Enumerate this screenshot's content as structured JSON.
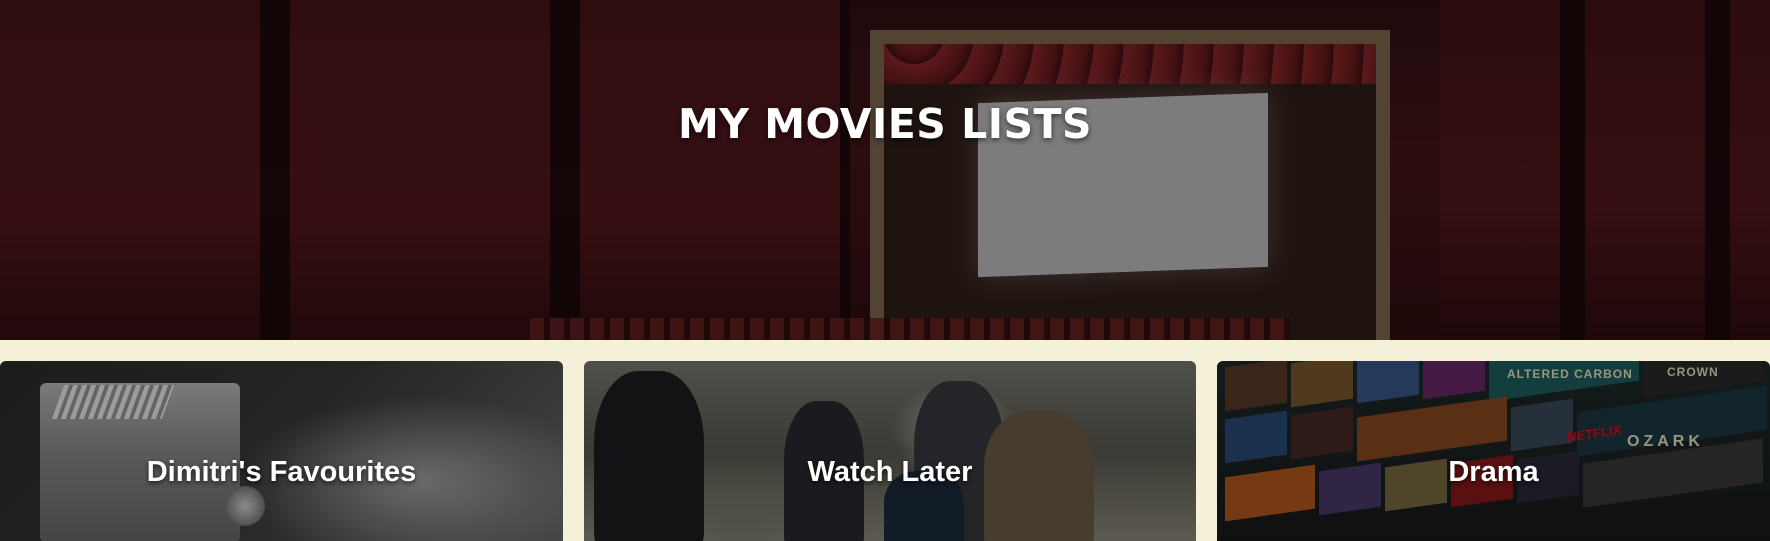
{
  "header": {
    "title": "MY MOVIES LISTS"
  },
  "lists": [
    {
      "label": "Dimitri's Favourites"
    },
    {
      "label": "Watch Later"
    },
    {
      "label": "Drama"
    }
  ],
  "card3_posters": {
    "netflix": "NETFLIX",
    "altered_carbon": "ALTERED CARBON",
    "crown": "CROWN",
    "ozark": "OZARK"
  },
  "colors": {
    "page_background": "#f5f1d9",
    "title_text": "#ffffff",
    "netflix_red": "#e50914"
  }
}
